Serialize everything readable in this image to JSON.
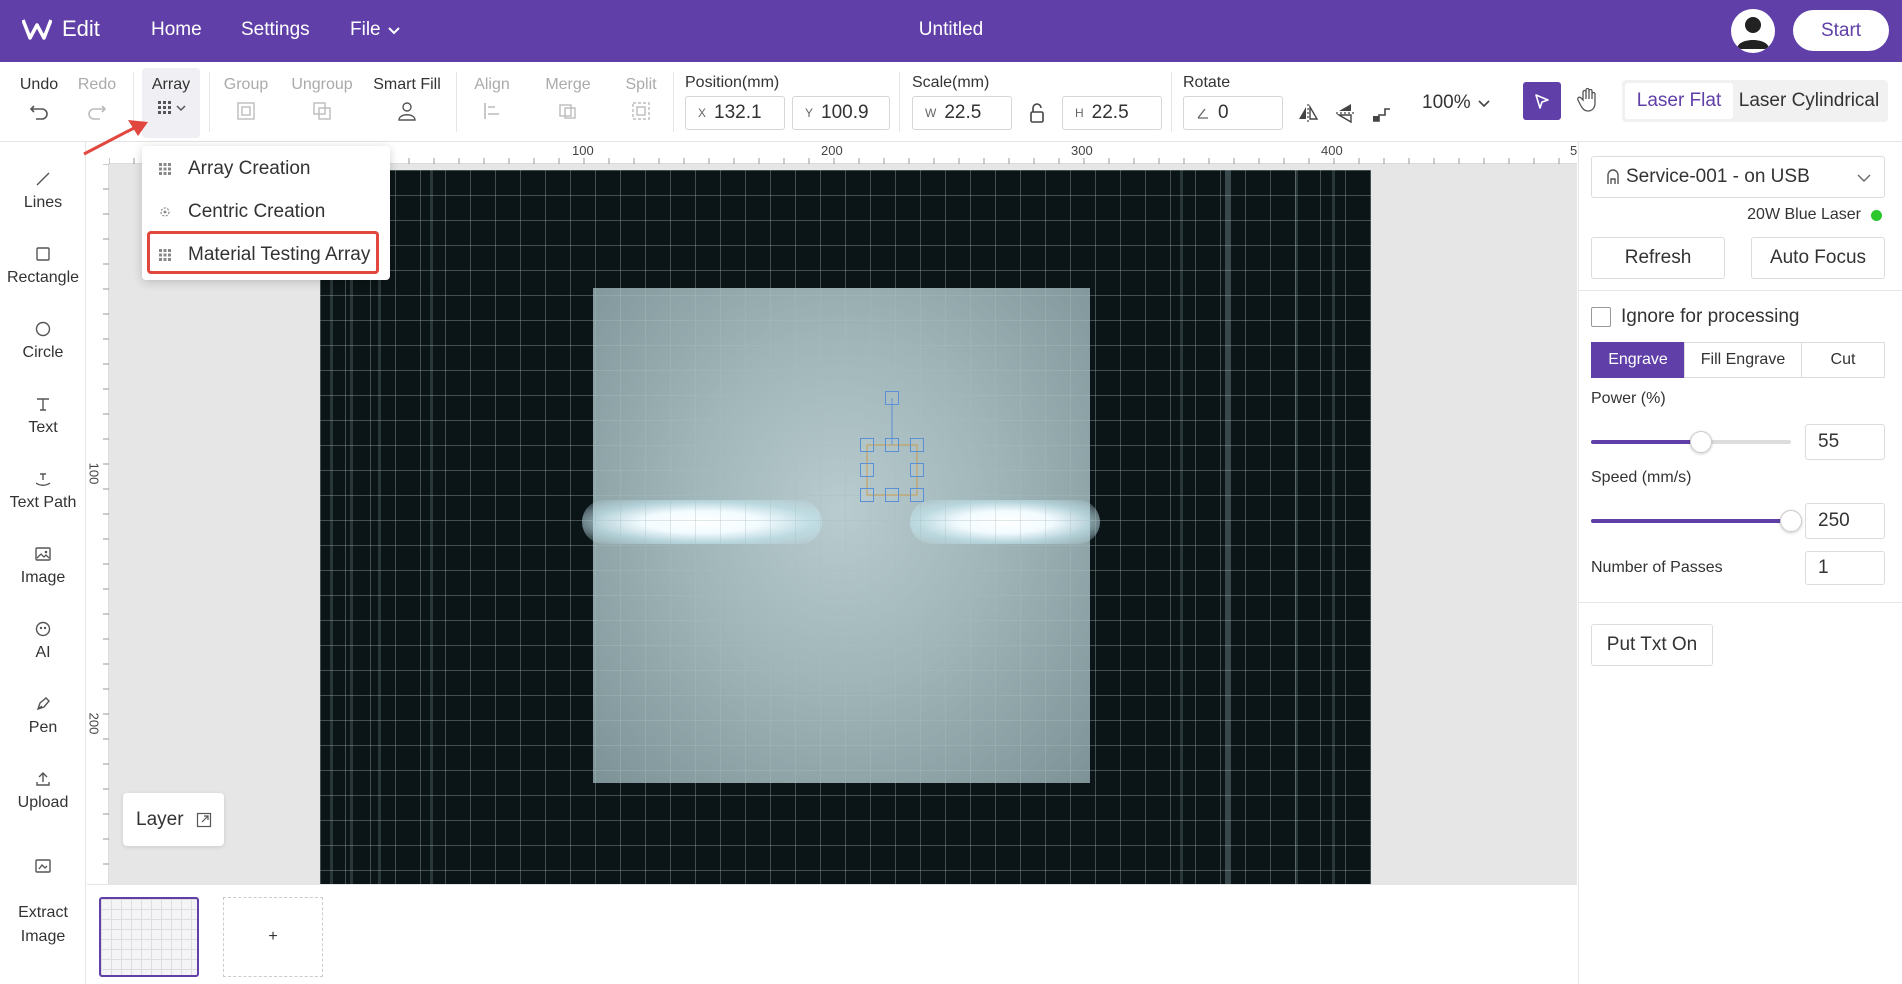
{
  "app": {
    "logo_text": "Edit",
    "nav": [
      "Home",
      "Settings",
      "File"
    ],
    "document_title": "Untitled",
    "start_label": "Start",
    "brand_color": "#6040a8"
  },
  "toolbar": {
    "undo": "Undo",
    "redo": "Redo",
    "array": "Array",
    "group": "Group",
    "ungroup": "Ungroup",
    "smart_fill": "Smart Fill",
    "align": "Align",
    "merge": "Merge",
    "split": "Split",
    "position_label": "Position(mm)",
    "pos_x_prefix": "X",
    "pos_x": "132.1",
    "pos_y_prefix": "Y",
    "pos_y": "100.9",
    "scale_label": "Scale(mm)",
    "scale_w_prefix": "W",
    "scale_w": "22.5",
    "scale_h_prefix": "H",
    "scale_h": "22.5",
    "rotate_label": "Rotate",
    "rotate_value": "0",
    "zoom": "100%",
    "laser_modes": [
      "Laser Flat",
      "Laser Cylindrical"
    ],
    "active_laser_mode": "Laser Flat"
  },
  "array_menu": {
    "items": [
      "Array Creation",
      "Centric Creation",
      "Material Testing Array"
    ],
    "highlighted": "Material Testing Array"
  },
  "sidebar": {
    "tools": [
      {
        "label": "Lines",
        "icon": "line-icon"
      },
      {
        "label": "Rectangle",
        "icon": "rectangle-icon"
      },
      {
        "label": "Circle",
        "icon": "circle-icon"
      },
      {
        "label": "Text",
        "icon": "text-icon"
      },
      {
        "label": "Text Path",
        "icon": "text-path-icon"
      },
      {
        "label": "Image",
        "icon": "image-icon"
      },
      {
        "label": "AI",
        "icon": "ai-icon"
      },
      {
        "label": "Pen",
        "icon": "pen-icon"
      },
      {
        "label": "Upload",
        "icon": "upload-icon"
      },
      {
        "label": "Extract\nImage",
        "icon": "extract-image-icon"
      }
    ]
  },
  "canvas": {
    "ruler_top_labels": [
      "100",
      "200",
      "300",
      "400",
      "5"
    ],
    "ruler_left_labels": [
      "100",
      "200"
    ],
    "layer_label": "Layer",
    "add_page_label": "+"
  },
  "right_panel": {
    "device": "Service-001 - on USB",
    "laser_type": "20W Blue Laser",
    "status_color": "#2cc72c",
    "refresh": "Refresh",
    "auto_focus": "Auto Focus",
    "ignore_label": "Ignore for processing",
    "ignore_checked": false,
    "mode_tabs": [
      "Engrave",
      "Fill Engrave",
      "Cut"
    ],
    "active_mode": "Engrave",
    "power_label": "Power (%)",
    "power_value": "55",
    "power_fraction": 0.55,
    "speed_label": "Speed (mm/s)",
    "speed_value": "250",
    "speed_fraction": 1.0,
    "passes_label": "Number of Passes",
    "passes_value": "1",
    "put_txt_on": "Put Txt On"
  }
}
